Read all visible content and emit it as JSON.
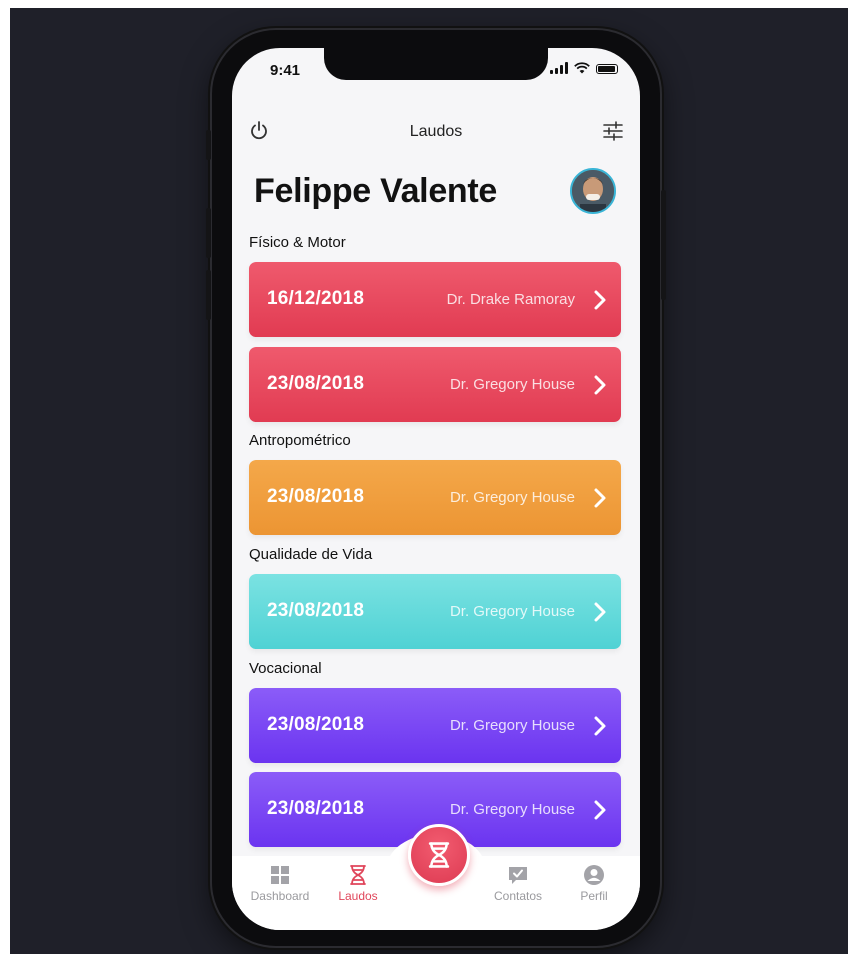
{
  "status_bar": {
    "time": "9:41"
  },
  "header": {
    "title": "Laudos"
  },
  "user": {
    "name": "Felippe Valente"
  },
  "sections": [
    {
      "title": "Físico & Motor",
      "color": "#e6475d",
      "reports": [
        {
          "date": "16/12/2018",
          "doctor": "Dr. Drake Ramoray"
        },
        {
          "date": "23/08/2018",
          "doctor": "Dr. Gregory House"
        }
      ]
    },
    {
      "title": "Antropométrico",
      "color": "#f0a03d",
      "reports": [
        {
          "date": "23/08/2018",
          "doctor": "Dr. Gregory House"
        }
      ]
    },
    {
      "title": "Qualidade de Vida",
      "color": "#62dadb",
      "reports": [
        {
          "date": "23/08/2018",
          "doctor": "Dr. Gregory House"
        }
      ]
    },
    {
      "title": "Vocacional",
      "color": "#7643f3",
      "reports": [
        {
          "date": "23/08/2018",
          "doctor": "Dr. Gregory House"
        },
        {
          "date": "23/08/2018",
          "doctor": "Dr. Gregory House"
        }
      ]
    }
  ],
  "tabbar": {
    "tabs": [
      {
        "label": "Dashboard",
        "icon": "grid-icon",
        "active": false
      },
      {
        "label": "Laudos",
        "icon": "dna-icon",
        "active": true
      },
      {
        "label": "Contatos",
        "icon": "chat-check-icon",
        "active": false
      },
      {
        "label": "Perfil",
        "icon": "user-icon",
        "active": false
      }
    ],
    "center_button_icon": "dna-icon"
  },
  "colors": {
    "accent": "#e0465b",
    "background": "#1f2029"
  }
}
